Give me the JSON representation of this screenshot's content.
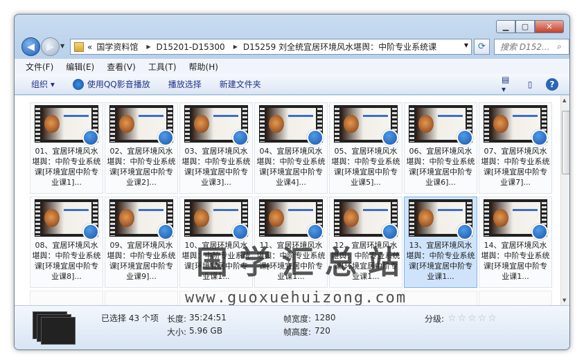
{
  "search": {
    "placeholder": "搜索 D152..."
  },
  "breadcrumb": {
    "overflow": "«",
    "items": [
      "国学资料馆",
      "D15201-D15300",
      "D15259 刘全统宜居环境风水堪舆：中阶专业系统课"
    ]
  },
  "menu": [
    "文件(F)",
    "编辑(E)",
    "查看(V)",
    "工具(T)",
    "帮助(H)"
  ],
  "commands": {
    "organize": "组织 ▾",
    "qq_play": "使用QQ影音播放",
    "play_selection": "播放选择",
    "new_folder": "新建文件夹"
  },
  "files": [
    {
      "label": "01、宜居环境风水堪舆：中阶专业系统课[环境宜居中阶专业课1]...",
      "selected": false
    },
    {
      "label": "02、宜居环境风水堪舆：中阶专业系统课[环境宜居中阶专业课2]...",
      "selected": false
    },
    {
      "label": "03、宜居环境风水堪舆：中阶专业系统课[环境宜居中阶专业课3]...",
      "selected": false
    },
    {
      "label": "04、宜居环境风水堪舆：中阶专业系统课[环境宜居中阶专业课4]...",
      "selected": false
    },
    {
      "label": "05、宜居环境风水堪舆：中阶专业系统课[环境宜居中阶专业课5]...",
      "selected": false
    },
    {
      "label": "06、宜居环境风水堪舆：中阶专业系统课[环境宜居中阶专业课6]...",
      "selected": false
    },
    {
      "label": "07、宜居环境风水堪舆：中阶专业系统课[环境宜居中阶专业课7]...",
      "selected": false
    },
    {
      "label": "08、宜居环境风水堪舆：中阶专业系统课[环境宜居中阶专业课8]...",
      "selected": false
    },
    {
      "label": "09、宜居环境风水堪舆：中阶专业系统课[环境宜居中阶专业课9]...",
      "selected": false
    },
    {
      "label": "10、宜居环境风水堪舆：中阶专业系统课[环境宜居中阶专业课1...",
      "selected": false
    },
    {
      "label": "11、宜居环境风水堪舆：中阶专业系统课[环境宜居中阶专业课1...",
      "selected": false
    },
    {
      "label": "12、宜居环境风水堪舆：中阶专业系统课[环境宜居中阶专业课1...",
      "selected": false
    },
    {
      "label": "13、宜居环境风水堪舆：中阶专业系统课[环境宜居中阶专业课1...",
      "selected": true
    },
    {
      "label": "14、宜居环境风水堪舆：中阶专业系统课[环境宜居中阶专业课1...",
      "selected": false
    }
  ],
  "status": {
    "selected": "已选择 43 个项",
    "length_label": "长度:",
    "length": "35:24:51",
    "size_label": "大小:",
    "size": "5.96 GB",
    "width_label": "帧宽度:",
    "width": "1280",
    "height_label": "帧高度:",
    "height": "720",
    "rating_label": "分级:",
    "rating_stars": 0
  },
  "watermark": {
    "title": "国学汇总站",
    "url": "www.guoxuehuizong.com"
  },
  "colors": {
    "selection": "#cfe4fb",
    "link": "#1e3287",
    "close": "#c4402b"
  }
}
